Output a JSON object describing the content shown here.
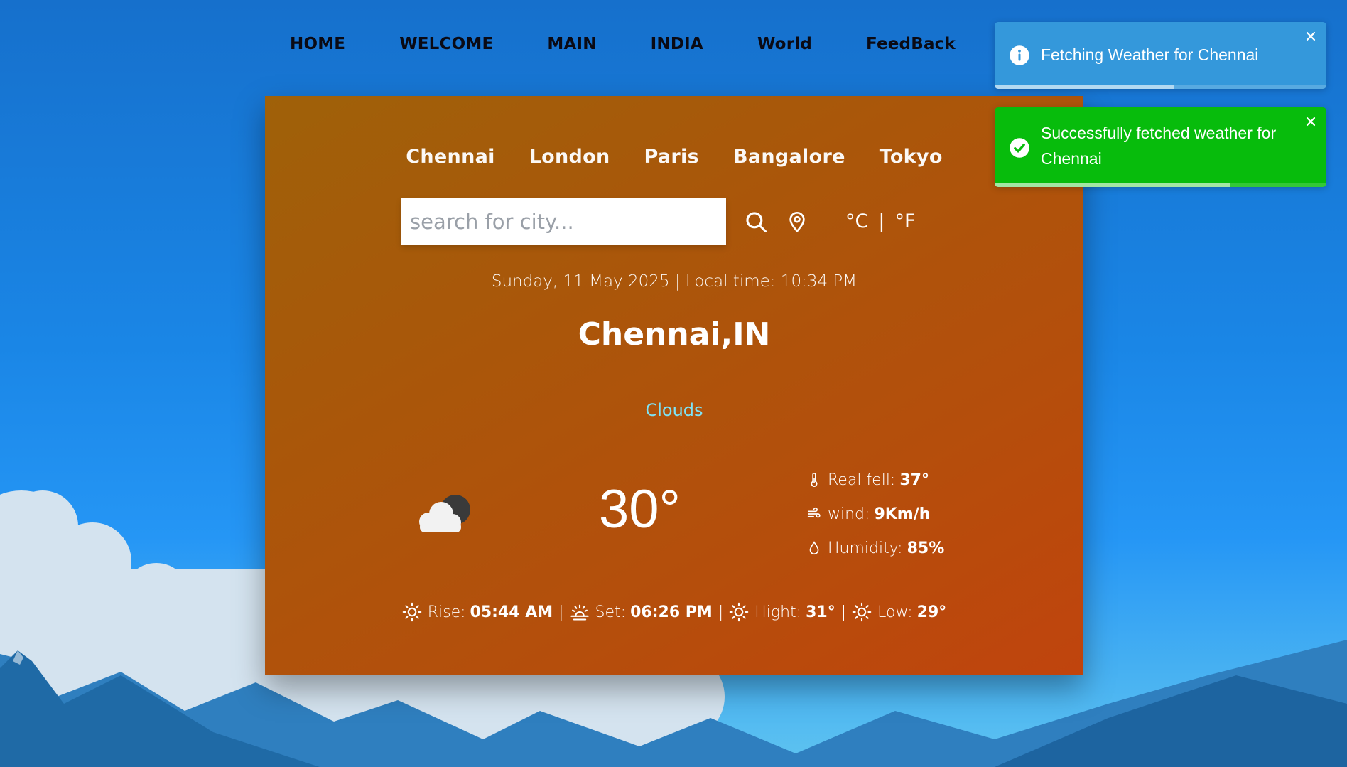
{
  "nav": {
    "items": [
      "HOME",
      "WELCOME",
      "MAIN",
      "INDIA",
      "World",
      "FeedBack"
    ]
  },
  "quick_cities": [
    "Chennai",
    "London",
    "Paris",
    "Bangalore",
    "Tokyo"
  ],
  "search": {
    "placeholder": "search for city...",
    "value": ""
  },
  "units": {
    "celsius": "°C",
    "separator": "|",
    "fahrenheit": "°F"
  },
  "weather": {
    "datetime": "Sunday, 11 May 2025 | Local time: 10:34 PM",
    "city": "Chennai,IN",
    "condition": "Clouds",
    "temperature": "30°",
    "icon": "cloud-night-icon",
    "details": {
      "real_feel_label": "Real fell:",
      "real_feel_value": "37°",
      "wind_label": "wind:",
      "wind_value": "9Km/h",
      "humidity_label": "Humidity:",
      "humidity_value": "85%"
    },
    "sun": {
      "rise_label": "Rise:",
      "rise_value": "05:44 AM",
      "set_label": "Set:",
      "set_value": "06:26 PM",
      "high_label": "Hight:",
      "high_value": "31°",
      "low_label": "Low:",
      "low_value": "29°",
      "separator": "|"
    }
  },
  "toasts": [
    {
      "type": "info",
      "message": "Fetching Weather for Chennai",
      "color": "#3498db",
      "progress": 0.54
    },
    {
      "type": "success",
      "message": "Successfully fetched weather for Chennai",
      "color": "#07bc0c",
      "progress": 0.71
    }
  ],
  "colors": {
    "card_start": "#9f6109",
    "card_end": "#c0440d",
    "condition_text": "#7ee3f6",
    "nav_text": "#0a0a14"
  }
}
